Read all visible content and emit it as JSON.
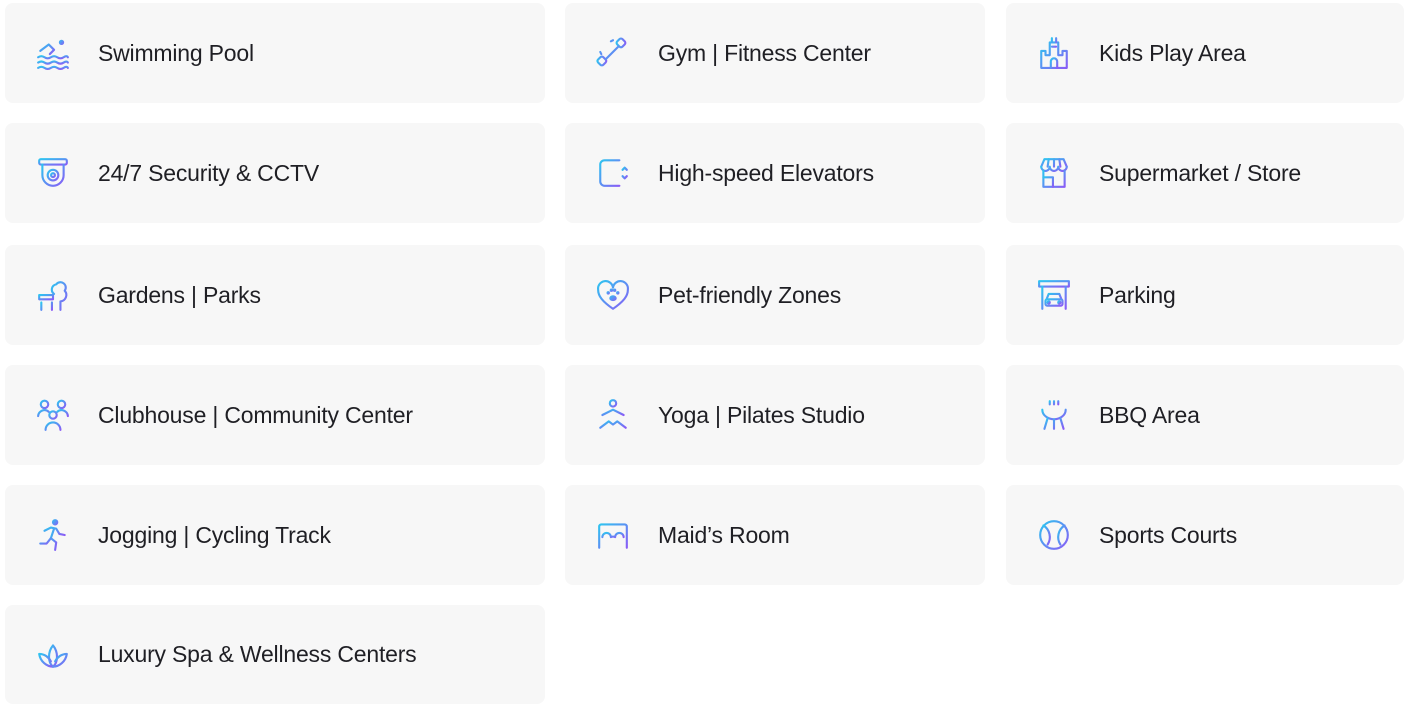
{
  "accent": {
    "gradient_start": "#2ec5f0",
    "gradient_end": "#8a5cf6"
  },
  "amenities": [
    {
      "label": "Swimming Pool",
      "icon": "swimming-pool-icon"
    },
    {
      "label": "Gym | Fitness Center",
      "icon": "dumbbell-icon"
    },
    {
      "label": "Kids Play Area",
      "icon": "castle-icon"
    },
    {
      "label": "24/7 Security & CCTV",
      "icon": "cctv-camera-icon"
    },
    {
      "label": "High-speed Elevators",
      "icon": "elevator-icon"
    },
    {
      "label": "Supermarket / Store",
      "icon": "store-icon"
    },
    {
      "label": "Gardens | Parks",
      "icon": "park-bench-tree-icon"
    },
    {
      "label": "Pet-friendly Zones",
      "icon": "heart-paw-icon"
    },
    {
      "label": "Parking",
      "icon": "car-garage-icon"
    },
    {
      "label": "Clubhouse | Community Center",
      "icon": "community-people-icon"
    },
    {
      "label": "Yoga | Pilates Studio",
      "icon": "yoga-pose-icon"
    },
    {
      "label": "BBQ Area",
      "icon": "bbq-grill-icon"
    },
    {
      "label": "Jogging | Cycling Track",
      "icon": "runner-icon"
    },
    {
      "label": "Maid’s Room",
      "icon": "bed-icon"
    },
    {
      "label": "Sports Courts",
      "icon": "tennis-ball-icon"
    },
    {
      "label": "Luxury Spa & Wellness Centers",
      "icon": "lotus-icon"
    }
  ]
}
